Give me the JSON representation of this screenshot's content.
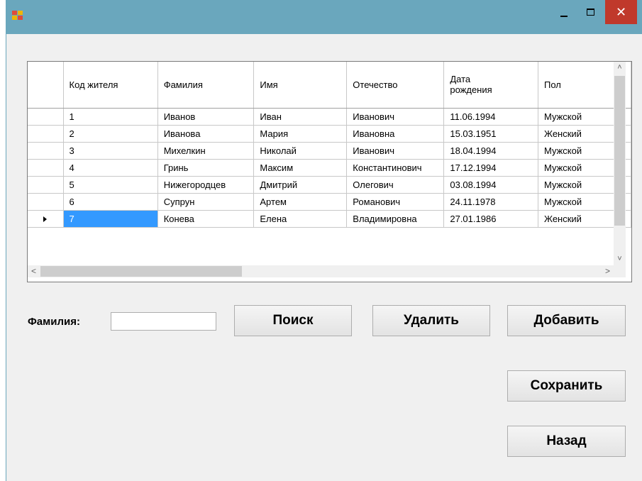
{
  "window": {
    "title": "",
    "close_glyph": "✕"
  },
  "grid": {
    "columns": [
      "Код жителя",
      "Фамилия",
      "Имя",
      "Отечество",
      "Дата\nрождения",
      "Пол"
    ],
    "rows": [
      [
        "1",
        "Иванов",
        "Иван",
        "Иванович",
        "11.06.1994",
        "Мужской"
      ],
      [
        "2",
        "Иванова",
        "Мария",
        "Ивановна",
        "15.03.1951",
        "Женский"
      ],
      [
        "3",
        "Михелкин",
        "Николай",
        "Иванович",
        "18.04.1994",
        "Мужской"
      ],
      [
        "4",
        "Гринь",
        "Максим",
        "Константинович",
        "17.12.1994",
        "Мужской"
      ],
      [
        "5",
        "Нижегородцев",
        "Дмитрий",
        "Олегович",
        "03.08.1994",
        "Мужской"
      ],
      [
        "6",
        "Супрун",
        "Артем",
        "Романович",
        "24.11.1978",
        "Мужской"
      ],
      [
        "7",
        "Конева",
        "Елена",
        "Владимировна",
        "27.01.1986",
        "Женский"
      ]
    ],
    "current_row": 6,
    "selected_cell": [
      6,
      0
    ]
  },
  "form": {
    "surname_label": "Фамилия:",
    "surname_value": ""
  },
  "buttons": {
    "search": "Поиск",
    "delete": "Удалить",
    "add": "Добавить",
    "save": "Сохранить",
    "back": "Назад"
  },
  "scroll_glyphs": {
    "up": "˄",
    "down": "˅",
    "left": "<",
    "right": ">"
  },
  "colors": {
    "titlebar": "#6aa7bd",
    "selection": "#3399ff",
    "close": "#c0392b"
  }
}
